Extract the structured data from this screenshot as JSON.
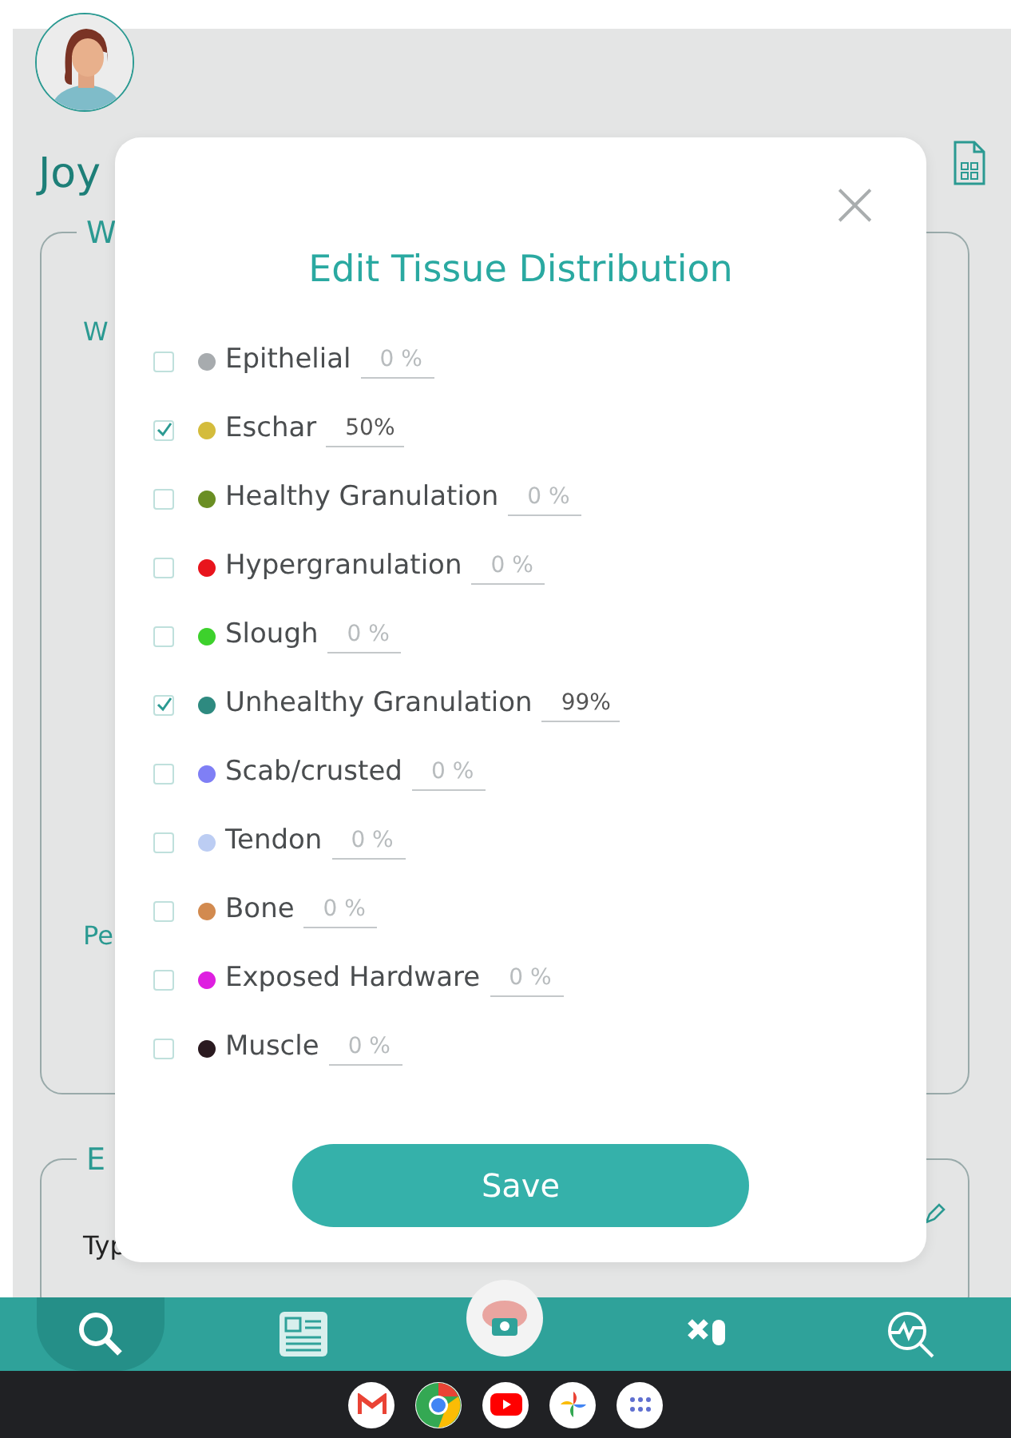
{
  "background": {
    "patient_name": "Joy",
    "card_1": {
      "legend": "W",
      "label_1": "W",
      "label_2": "Pe"
    },
    "card_2": {
      "legend": "E",
      "label": "Typ"
    }
  },
  "dialog": {
    "title": "Edit Tissue Distribution",
    "close": "×",
    "tissues": [
      {
        "name": "Epithelial",
        "color": "#a7abae",
        "checked": false,
        "percent": "0 %"
      },
      {
        "name": "Eschar",
        "color": "#d4bc3c",
        "checked": true,
        "percent": "50%"
      },
      {
        "name": "Healthy Granulation",
        "color": "#6a8e23",
        "checked": false,
        "percent": "0 %"
      },
      {
        "name": "Hypergranulation",
        "color": "#e8141c",
        "checked": false,
        "percent": "0 %"
      },
      {
        "name": "Slough",
        "color": "#3dd12c",
        "checked": false,
        "percent": "0 %"
      },
      {
        "name": "Unhealthy Granulation",
        "color": "#2e8a80",
        "checked": true,
        "percent": "99%"
      },
      {
        "name": "Scab/crusted",
        "color": "#7f7ff5",
        "checked": false,
        "percent": "0 %"
      },
      {
        "name": "Tendon",
        "color": "#bccdf3",
        "checked": false,
        "percent": "0 %"
      },
      {
        "name": "Bone",
        "color": "#d28a4f",
        "checked": false,
        "percent": "0 %"
      },
      {
        "name": "Exposed Hardware",
        "color": "#de1fe0",
        "checked": false,
        "percent": "0 %"
      },
      {
        "name": "Muscle",
        "color": "#2a1a20",
        "checked": false,
        "percent": "0 %"
      }
    ],
    "save": "Save"
  },
  "bottom_nav": [
    {
      "kind": "search",
      "selected": true
    },
    {
      "kind": "report",
      "selected": false
    },
    {
      "kind": "camera",
      "selected": false
    },
    {
      "kind": "pills",
      "selected": false
    },
    {
      "kind": "analytics",
      "selected": false
    }
  ],
  "shelf": [
    {
      "kind": "mail"
    },
    {
      "kind": "chrome"
    },
    {
      "kind": "video"
    },
    {
      "kind": "photos"
    },
    {
      "kind": "apps"
    }
  ]
}
